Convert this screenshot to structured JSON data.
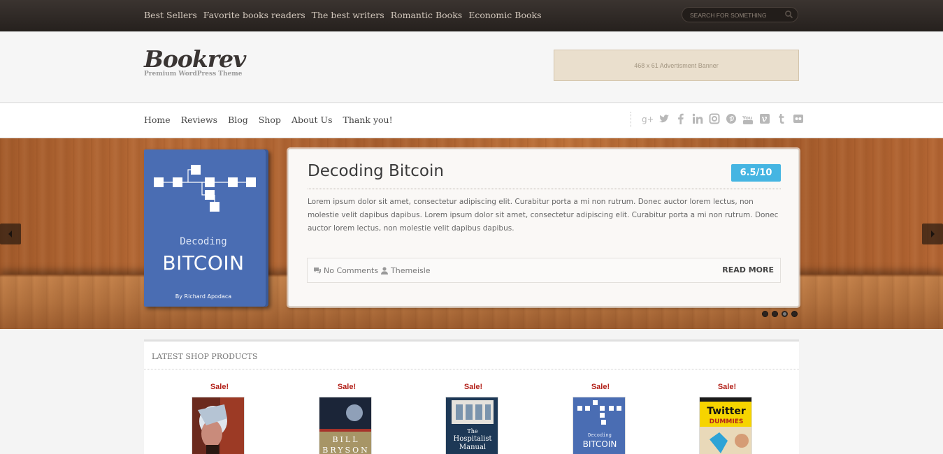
{
  "topbar": {
    "links": [
      "Best Sellers",
      "Favorite books readers",
      "The best writers",
      "Romantic Books",
      "Economic Books"
    ],
    "search_placeholder": "SEARCH FOR SOMETHING"
  },
  "header": {
    "logo_name": "Bookrev",
    "logo_tagline": "Premium WordPress Theme",
    "ad_banner_text": "468 x 61 Advertisment Banner"
  },
  "nav": {
    "items": [
      "Home",
      "Reviews",
      "Blog",
      "Shop",
      "About Us",
      "Thank you!"
    ],
    "social_icons": [
      "google-plus-icon",
      "twitter-icon",
      "facebook-icon",
      "linkedin-icon",
      "instagram-icon",
      "pinterest-icon",
      "youtube-icon",
      "vimeo-icon",
      "tumblr-icon",
      "flickr-icon"
    ]
  },
  "slider": {
    "book": {
      "subtitle": "Decoding",
      "title": "BITCOIN",
      "author": "By Richard Apodaca"
    },
    "review": {
      "title": "Decoding Bitcoin",
      "score": "6.5/10",
      "text": "Lorem ipsum dolor sit amet, consectetur adipiscing elit. Curabitur porta a mi non rutrum. Donec auctor lorem lectus, non molestie velit dapibus dapibus.  Lorem ipsum dolor sit amet, consectetur adipiscing elit. Curabitur porta a mi non rutrum. Donec auctor lorem lectus, non molestie velit dapibus dapibus.",
      "comments": "No Comments",
      "author": "Themeisle",
      "read_more": "READ MORE"
    },
    "dots_count": 4,
    "active_dot": 2
  },
  "products": {
    "heading": "LATEST SHOP PRODUCTS",
    "items": [
      {
        "badge": "Sale!",
        "cover": "portrait"
      },
      {
        "badge": "Sale!",
        "cover": "bill-bryson",
        "cover_text": "BILL BRYSON"
      },
      {
        "badge": "Sale!",
        "cover": "hospitalist",
        "cover_text_top": "The",
        "cover_text": "Hospitalist",
        "cover_text_bottom": "Manual"
      },
      {
        "badge": "Sale!",
        "cover": "bitcoin",
        "cover_text_top": "Decoding",
        "cover_text": "BITCOIN"
      },
      {
        "badge": "Sale!",
        "cover": "twitter-dummies",
        "cover_text_top": "Twitter",
        "cover_text": "DUMMIES"
      }
    ]
  },
  "colors": {
    "score_badge": "#45b5e2",
    "sale_text": "#b3211a",
    "book_cover": "#4a6db3"
  }
}
